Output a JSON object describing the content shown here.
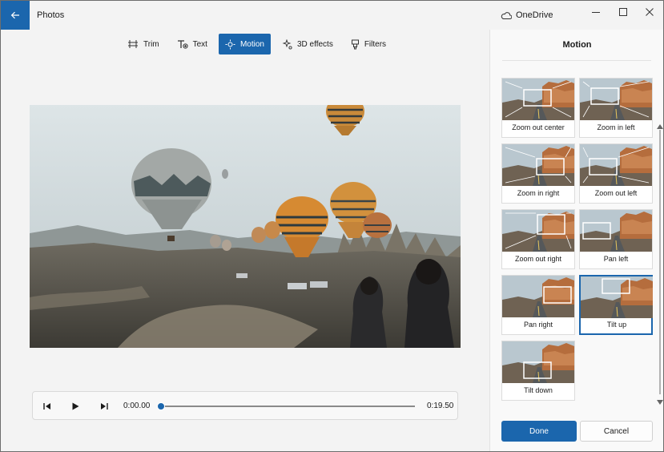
{
  "app": {
    "title": "Photos",
    "cloud_label": "OneDrive"
  },
  "toolbar": [
    {
      "id": "trim",
      "label": "Trim",
      "icon": "trim-icon",
      "active": false
    },
    {
      "id": "text",
      "label": "Text",
      "icon": "text-icon",
      "active": false
    },
    {
      "id": "motion",
      "label": "Motion",
      "icon": "motion-icon",
      "active": true
    },
    {
      "id": "effects",
      "label": "3D effects",
      "icon": "3d-effects-icon",
      "active": false
    },
    {
      "id": "filters",
      "label": "Filters",
      "icon": "filters-icon",
      "active": false
    }
  ],
  "player": {
    "current_time": "0:00.00",
    "total_time": "0:19.50",
    "progress": 0
  },
  "panel": {
    "title": "Motion",
    "options": [
      {
        "label": "Zoom out center",
        "selected": false
      },
      {
        "label": "Zoom in left",
        "selected": false
      },
      {
        "label": "Zoom in right",
        "selected": false
      },
      {
        "label": "Zoom out left",
        "selected": false
      },
      {
        "label": "Zoom out right",
        "selected": false
      },
      {
        "label": "Pan left",
        "selected": false
      },
      {
        "label": "Pan right",
        "selected": false
      },
      {
        "label": "Tilt up",
        "selected": true
      },
      {
        "label": "Tilt down",
        "selected": false
      }
    ],
    "done_label": "Done",
    "cancel_label": "Cancel"
  },
  "colors": {
    "accent": "#1b66ad",
    "background": "#f3f3f3"
  }
}
